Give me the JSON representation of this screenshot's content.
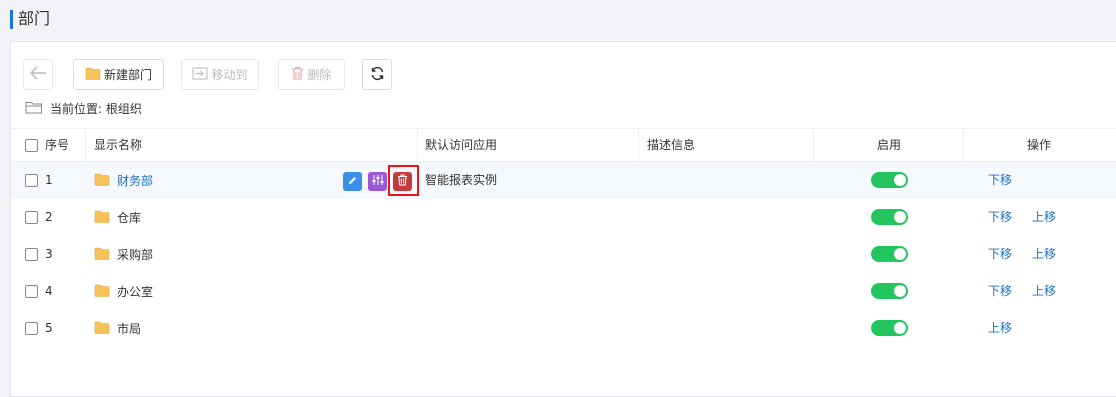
{
  "page": {
    "title": "部门"
  },
  "toolbar": {
    "new_dept": "新建部门",
    "move_to": "移动到",
    "delete": "删除"
  },
  "location": {
    "label": "当前位置: 根组织"
  },
  "table": {
    "headers": {
      "index": "序号",
      "display_name": "显示名称",
      "default_app": "默认访问应用",
      "description": "描述信息",
      "enabled": "启用",
      "actions": "操作"
    },
    "rows": [
      {
        "index": "1",
        "name": "财务部",
        "default_app": "智能报表实例",
        "enabled": true,
        "op1": "下移",
        "op2": ""
      },
      {
        "index": "2",
        "name": "仓库",
        "default_app": "",
        "enabled": true,
        "op1": "下移",
        "op2": "上移"
      },
      {
        "index": "3",
        "name": "采购部",
        "default_app": "",
        "enabled": true,
        "op1": "下移",
        "op2": "上移"
      },
      {
        "index": "4",
        "name": "办公室",
        "default_app": "",
        "enabled": true,
        "op1": "下移",
        "op2": "上移"
      },
      {
        "index": "5",
        "name": "市局",
        "default_app": "",
        "enabled": true,
        "op1": "上移",
        "op2": ""
      }
    ]
  },
  "colors": {
    "accent": "#1677d8",
    "toggle_on": "#22c55e",
    "link": "#1f6fbf",
    "edit_btn": "#3b8fe8",
    "adjust_btn": "#9a58d6",
    "delete_btn": "#c43b3b",
    "highlight_box": "#e11111"
  },
  "icons": {
    "back": "arrow-left-icon",
    "folder": "folder-icon",
    "move": "move-icon",
    "trash": "trash-icon",
    "refresh": "refresh-icon",
    "location": "folder-outline-icon",
    "edit": "pencil-icon",
    "adjust": "sliders-icon"
  }
}
